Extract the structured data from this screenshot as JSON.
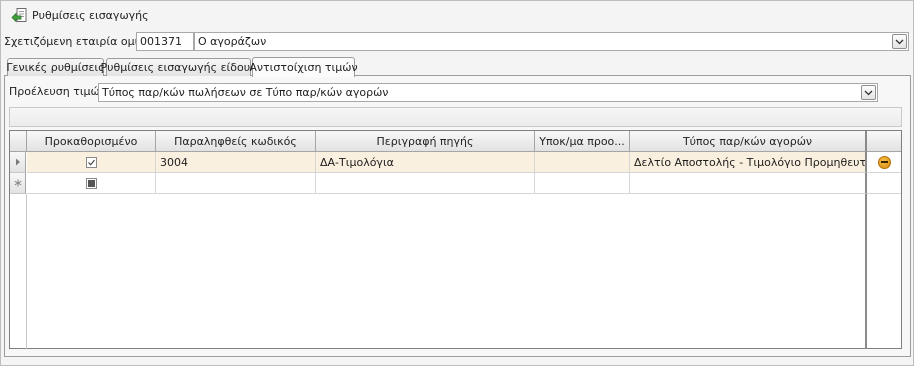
{
  "header": {
    "title": "Ρυθμίσεις εισαγωγής",
    "icon": "import-arrow-icon"
  },
  "company": {
    "label": "Σχετιζόμενη εταιρία ομίλου",
    "code": "001371",
    "name": "Ο αγοράζων"
  },
  "tabs": [
    {
      "label": "Γενικές ρυθμίσεις",
      "active": false
    },
    {
      "label": "Ρυθμίσεις εισαγωγής είδους",
      "active": false
    },
    {
      "label": "Αντιστοίχιση τιμών",
      "active": true
    }
  ],
  "source": {
    "label": "Προέλευση τιμών",
    "value": "Τύπος παρ/κών πωλήσεων σε Τύπο παρ/κών αγορών"
  },
  "grid": {
    "columns": [
      "Προκαθορισμένο",
      "Παραληφθείς κωδικός",
      "Περιγραφή πηγής",
      "Υποκ/μα προο...",
      "Τύπος παρ/κών αγορών"
    ],
    "rows": [
      {
        "default": true,
        "code": "3004",
        "description": "ΔΑ-Τιμολόγια",
        "sub": "",
        "type": "Δελτίο Αποστολής - Τιμολόγιο Προμηθευτή"
      }
    ],
    "new_row_default": "indeterminate"
  },
  "colors": {
    "selected_row": "#faf0e0",
    "remove_icon": "#e0960f"
  }
}
